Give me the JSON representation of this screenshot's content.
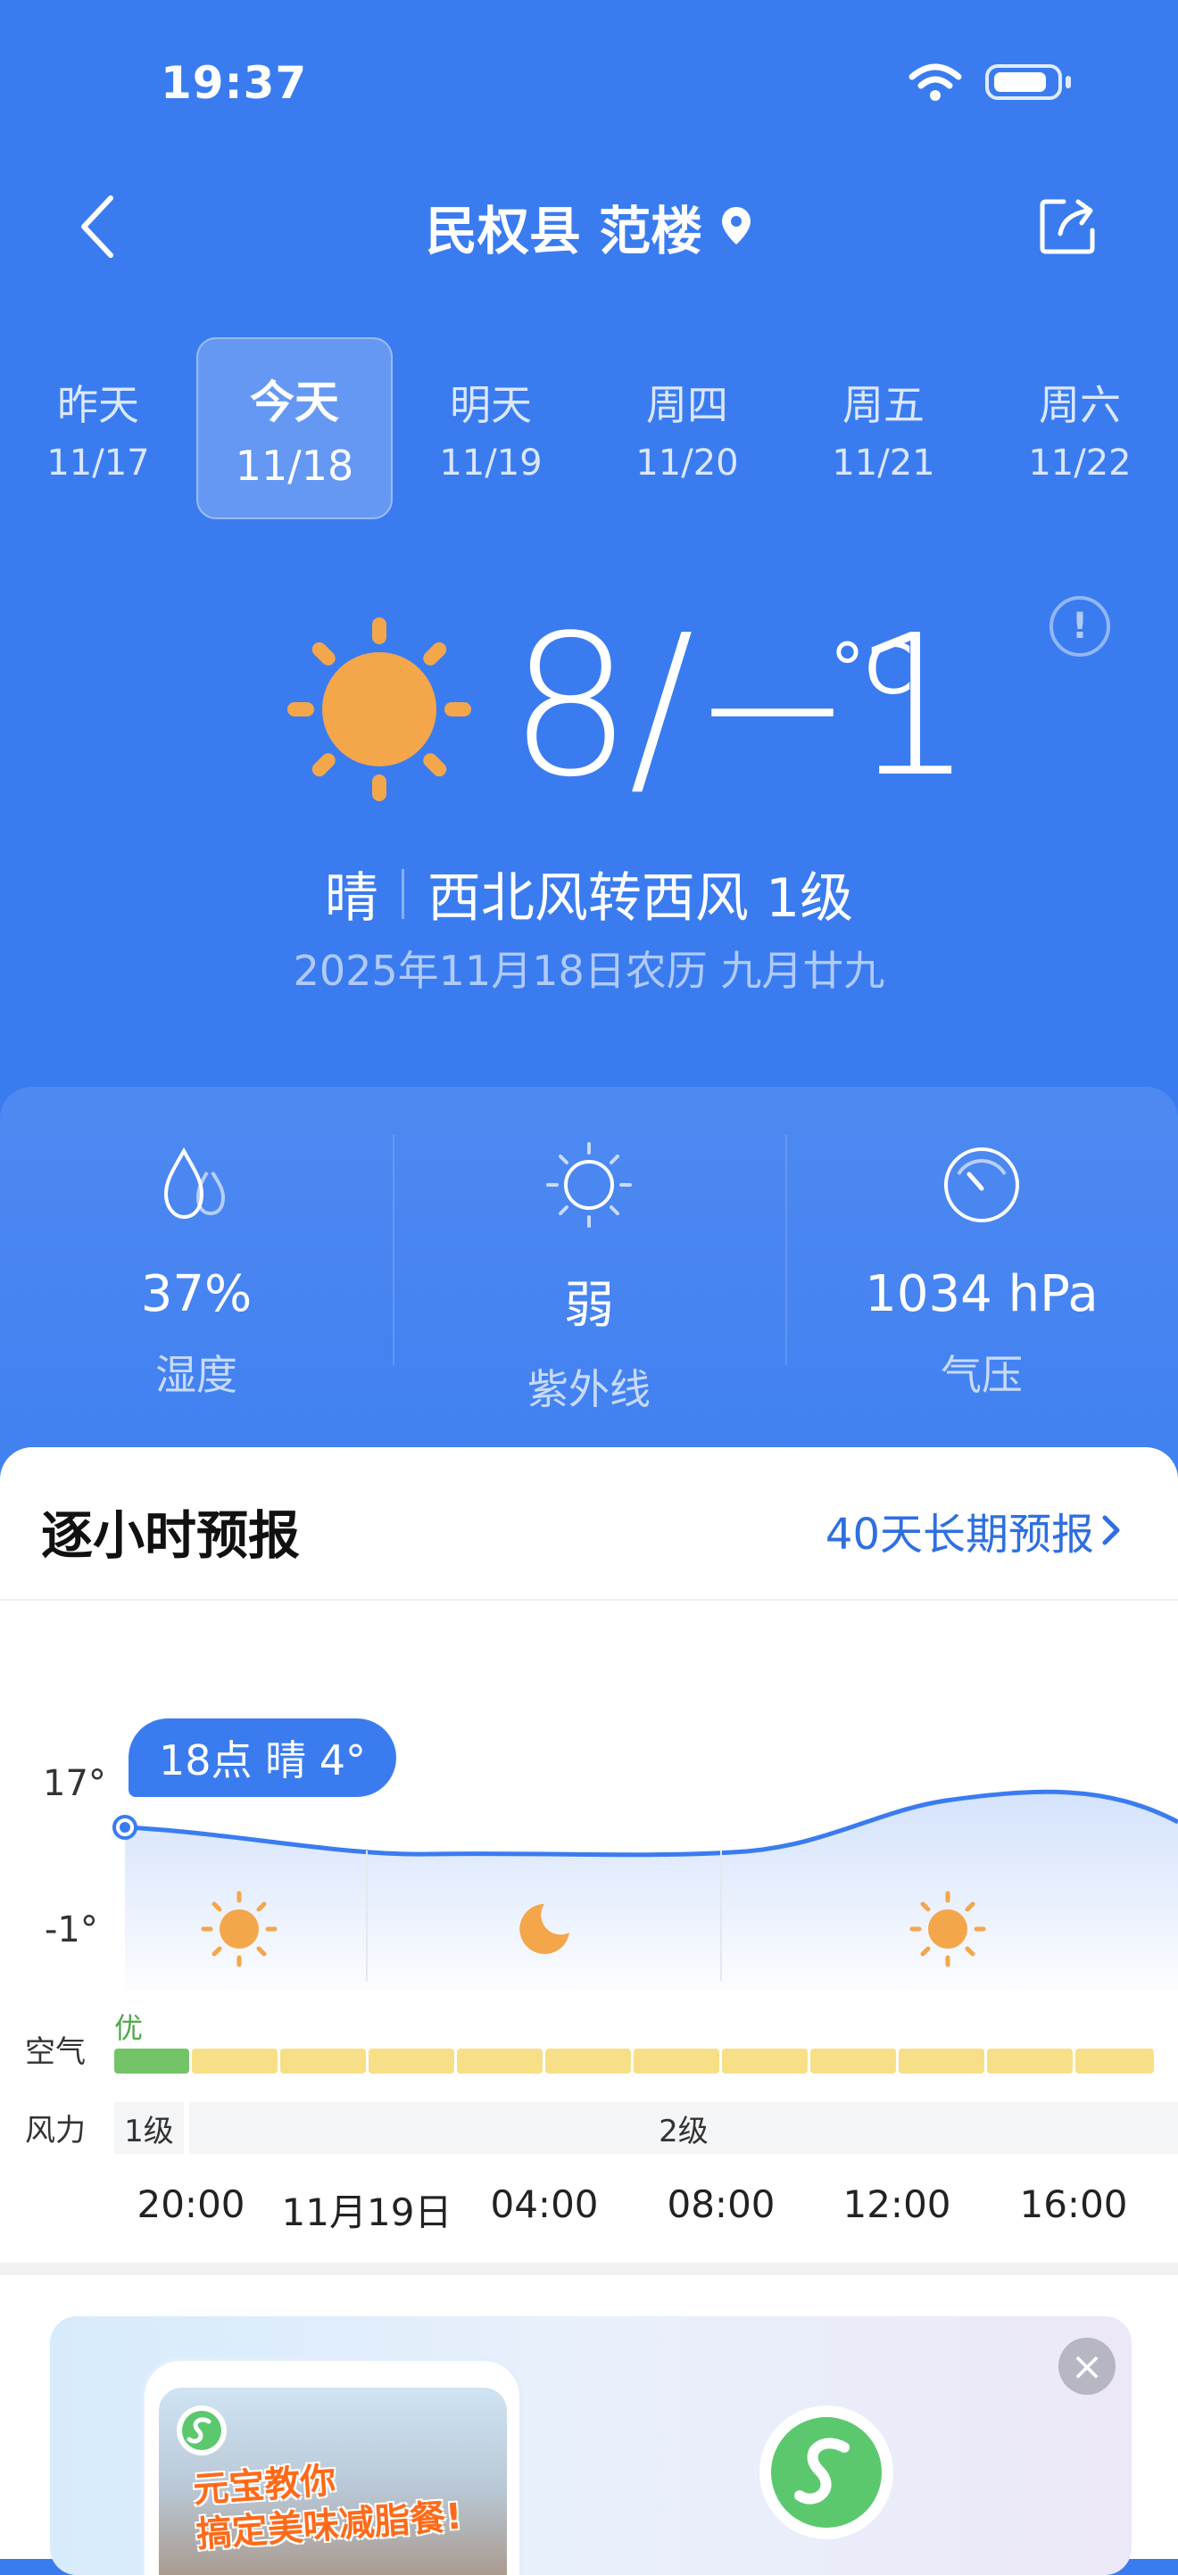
{
  "status_bar": {
    "time": "19:37"
  },
  "header": {
    "location": "民权县 范楼"
  },
  "day_tabs": [
    {
      "day": "昨天",
      "date": "11/17"
    },
    {
      "day": "今天",
      "date": "11/18"
    },
    {
      "day": "明天",
      "date": "11/19"
    },
    {
      "day": "周四",
      "date": "11/20"
    },
    {
      "day": "周五",
      "date": "11/21"
    },
    {
      "day": "周六",
      "date": "11/22"
    }
  ],
  "current": {
    "temp_range": "8/−1",
    "unit": "°C",
    "condition": "晴",
    "wind": "西北风转西风 1级",
    "date_line": "2025年11月18日农历 九月廿九"
  },
  "stats": [
    {
      "value": "37%",
      "label": "湿度",
      "icon": "humidity-icon"
    },
    {
      "value": "弱",
      "label": "紫外线",
      "icon": "uv-sun-icon"
    },
    {
      "value": "1034 hPa",
      "label": "气压",
      "icon": "pressure-gauge-icon"
    }
  ],
  "hourly": {
    "title": "逐小时预报",
    "long_link": "40天长期预报",
    "y_high": "17°",
    "y_low": "-1°",
    "tooltip": "18点 晴 4°",
    "air_label": "空气",
    "air_first_tag": "优",
    "wind_label": "风力",
    "wind_first": "1级",
    "wind_rest": "2级",
    "time_labels": [
      "20:00",
      "11月19日",
      "04:00",
      "08:00",
      "12:00",
      "16:00"
    ]
  },
  "ad": {
    "headline_1": "元宝教你",
    "headline_2": "搞定美味减脂餐!"
  },
  "colors": {
    "background": "#3a7cf0",
    "sun": "#f4a64b",
    "accent": "#2e6fe0",
    "aq_good": "#74c368",
    "aq_moderate": "#f7df87"
  }
}
